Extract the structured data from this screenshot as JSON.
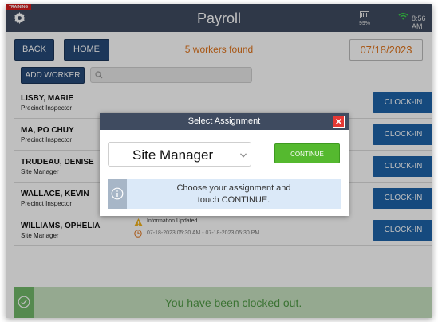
{
  "header": {
    "training_badge": "TRAINING",
    "title": "Payroll",
    "battery_percent": "99%",
    "time": "8:56 AM",
    "icons": [
      "gear-icon",
      "battery-icon",
      "wifi-icon"
    ]
  },
  "nav": {
    "back_label": "BACK",
    "home_label": "HOME",
    "workers_found": "5 workers found",
    "date": "07/18/2023"
  },
  "toolbar": {
    "add_worker_label": "ADD WORKER",
    "search_value": ""
  },
  "workers": [
    {
      "name": "LISBY, MARIE",
      "role": "Precinct Inspector",
      "action": "CLOCK-IN"
    },
    {
      "name": "MA, PO CHUY",
      "role": "Precinct Inspector",
      "action": "CLOCK-IN"
    },
    {
      "name": "TRUDEAU, DENISE",
      "role": "Site Manager",
      "action": "CLOCK-IN"
    },
    {
      "name": "WALLACE, KEVIN",
      "role": "Precinct Inspector",
      "action": "CLOCK-IN"
    },
    {
      "name": "WILLIAMS, OPHELIA",
      "role": "Site Manager",
      "action": "CLOCK-IN",
      "status": "Information Updated",
      "time_range": "07-18-2023 05:30 AM - 07-18-2023 05:30 PM"
    }
  ],
  "modal": {
    "title": "Select Assignment",
    "selected_assignment": "Site Manager",
    "continue_label": "CONTINUE",
    "info_line1": "Choose your assignment and",
    "info_line2": "touch CONTINUE."
  },
  "toast": {
    "message": "You have been clocked out."
  },
  "colors": {
    "header_bg": "#3f4b60",
    "nav_button": "#264a78",
    "accent_orange": "#e0731a",
    "clockin_blue": "#1e63a8",
    "continue_green": "#55b92f",
    "close_red": "#e53935",
    "toast_bg": "#c7e2c0"
  }
}
